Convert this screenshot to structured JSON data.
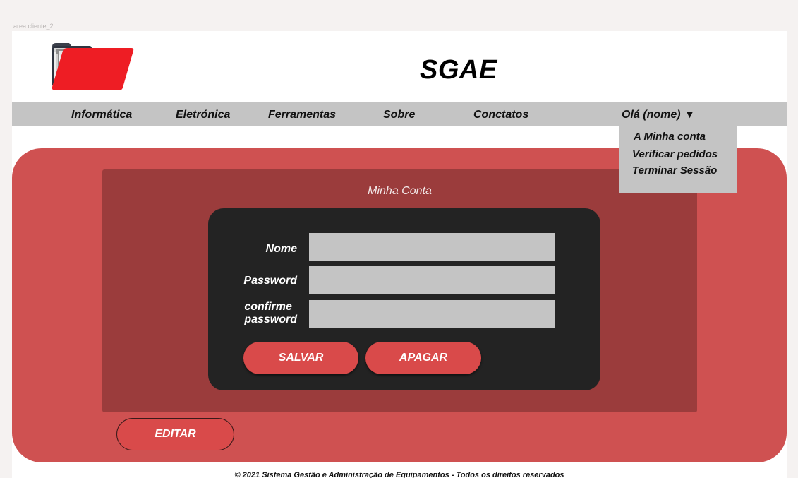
{
  "artboard": {
    "label": "area cliente_2"
  },
  "header": {
    "title": "SGAE"
  },
  "nav": {
    "items": [
      {
        "label": "Informática"
      },
      {
        "label": "Eletrónica"
      },
      {
        "label": "Ferramentas"
      },
      {
        "label": "Sobre"
      },
      {
        "label": "Conctatos"
      }
    ],
    "user_label": "Olá (nome)",
    "user_caret": "▼"
  },
  "dropdown": {
    "items": [
      {
        "label": "A Minha conta"
      },
      {
        "label": "Verificar pedidos"
      },
      {
        "label": "Terminar Sessão"
      }
    ]
  },
  "account": {
    "title": "Minha Conta",
    "fields": {
      "name_label": "Nome",
      "password_label": "Password",
      "confirm_label_line1": "confirme",
      "confirm_label_line2": "password",
      "name_value": "",
      "password_value": "",
      "confirm_value": ""
    },
    "save_label": "SALVAR",
    "delete_label": "APAGAR"
  },
  "edit_label": "EDITAR",
  "footer": {
    "text": "© 2021 Sistema Gestão e Administração de Equipamentos - Todos os direitos reservados"
  },
  "colors": {
    "panel": "#cf5151",
    "inner_panel": "#9b3c3c",
    "form_card": "#232323",
    "button": "#d94a4a",
    "nav_bg": "#c4c4c4",
    "logo_red": "#ee1d24"
  }
}
